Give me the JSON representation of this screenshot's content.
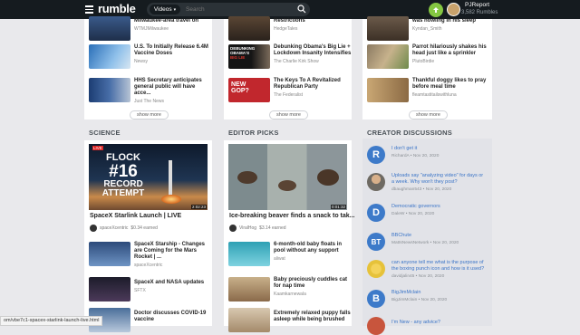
{
  "topbar": {
    "logo": "rumble",
    "search_category": "Videos",
    "search_placeholder": "Search",
    "user_name": "PJReport",
    "user_subscribers": "3,582 Rumbles",
    "colors": {
      "bar": "#151b1f",
      "accent": "#85c742"
    }
  },
  "col1_top": [
    {
      "title": "Milwaukee-area travel on",
      "channel": "WTMJMilwaukee",
      "duration": ""
    },
    {
      "title": "U.S. To Initially Release 6.4M Vaccine Doses",
      "channel": "Newsy",
      "duration": ""
    },
    {
      "title": "HHS Secretary anticipates general public will have acce...",
      "channel": "Just The News",
      "duration": ""
    }
  ],
  "col2_top": [
    {
      "title": "Restrictions",
      "channel": "HedgeTales",
      "duration": ""
    },
    {
      "title": "Debunking Obama's Big Lie + Lockdown Insanity Intensifies",
      "channel": "The Charlie Kirk Show",
      "duration": ""
    },
    {
      "title": "The Keys To A Revitalized Republican Party",
      "channel": "The Federalist",
      "duration": ""
    }
  ],
  "col3_top": [
    {
      "title": "was howling in his sleep",
      "channel": "Kyndan_Smith",
      "duration": ""
    },
    {
      "title": "Parrot hilariously shakes his head just like a sprinkler",
      "channel": "PlutoBirdie",
      "duration": ""
    },
    {
      "title": "Thankful doggy likes to pray before meal time",
      "channel": "fleamtastitailswithluna",
      "duration": ""
    }
  ],
  "show_more": "show more",
  "sections": {
    "science": "SCIENCE",
    "editor": "EDITOR PICKS",
    "creator": "CREATOR DISCUSSIONS"
  },
  "science_feature": {
    "title": "SpaceX Starlink Launch | LIVE",
    "channel": "spaceXcentric",
    "earned": "$0.34 earned",
    "thumb_text": [
      "FLOCK",
      "#16",
      "RECORD",
      "ATTEMPT"
    ],
    "duration": "2:02:23"
  },
  "editor_feature": {
    "title": "Ice-breaking beaver finds a snack to tak...",
    "channel": "ViralHog",
    "earned": "$3.14 earned",
    "duration": "0:01:32"
  },
  "science_list": [
    {
      "title": "SpaceX Starship - Changes are Coming for the Mars Rocket | ...",
      "channel": "spaceXcentric",
      "duration": ""
    },
    {
      "title": "SpaceX and NASA updates",
      "channel": "SFTX",
      "duration": ""
    },
    {
      "title": "Doctor discusses COVID-19 vaccine",
      "channel": "",
      "duration": ""
    }
  ],
  "editor_list": [
    {
      "title": "6-month-old baby floats in pool without any support",
      "channel": "aliwat",
      "duration": ""
    },
    {
      "title": "Baby preciously cuddles cat for nap time",
      "channel": "Kaamkarnewala",
      "duration": ""
    },
    {
      "title": "Extremely relaxed puppy falls asleep while being brushed",
      "channel": "",
      "duration": ""
    }
  ],
  "discussions": [
    {
      "initial": "R",
      "title": "I don't get it",
      "user": "RichardA",
      "date": "Nov 20, 2020",
      "color": "#3d7ac9"
    },
    {
      "initial": "",
      "title": "Uploads say \"analyzing video\" for days or a week. Why won't they post?",
      "user": "dbaughman543",
      "date": "Nov 20, 2020",
      "color": "#6e6a63"
    },
    {
      "initial": "D",
      "title": "Democratic governors",
      "user": "DaleW",
      "date": "Nov 20, 2020",
      "color": "#3d7ac9"
    },
    {
      "initial": "BT",
      "title": "BBChute",
      "user": "MattsNewsNetwork",
      "date": "Nov 20, 2020",
      "color": "#3d7ac9"
    },
    {
      "initial": "",
      "title": "can anyone tell me what is the purpose of the boxing punch icon and how is it used?",
      "user": "davidjalin45",
      "date": "Nov 20, 2020",
      "color": "#e6c23a"
    },
    {
      "initial": "B",
      "title": "BigJimMclain",
      "user": "BigJimMclain",
      "date": "Nov 20, 2020",
      "color": "#3d7ac9"
    },
    {
      "initial": "",
      "title": "I'm New - any advice?",
      "user": "",
      "date": "",
      "color": "#c8553d"
    }
  ],
  "status_url": "om/vbe7c1-spacex-starlink-launch-live.html"
}
